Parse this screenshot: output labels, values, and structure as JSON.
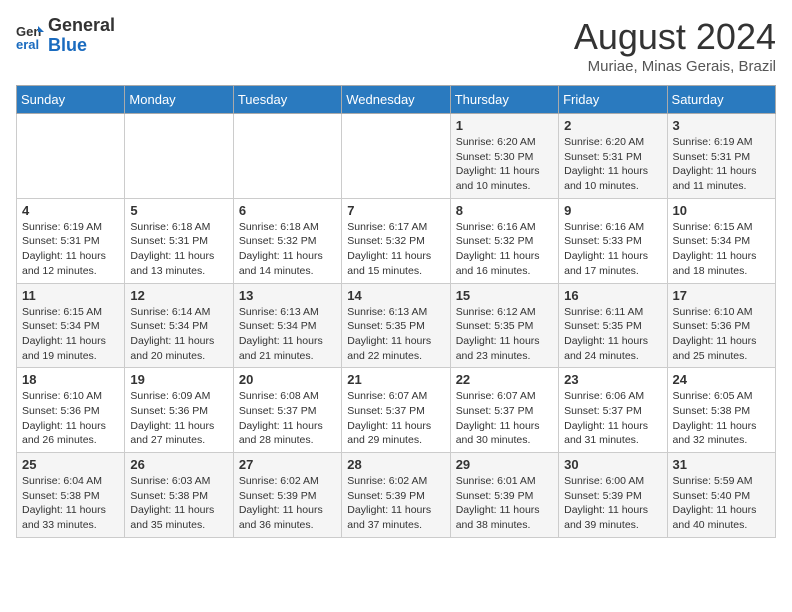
{
  "header": {
    "logo_line1": "General",
    "logo_line2": "Blue",
    "month_year": "August 2024",
    "location": "Muriae, Minas Gerais, Brazil"
  },
  "days_of_week": [
    "Sunday",
    "Monday",
    "Tuesday",
    "Wednesday",
    "Thursday",
    "Friday",
    "Saturday"
  ],
  "weeks": [
    [
      {
        "day": "",
        "info": ""
      },
      {
        "day": "",
        "info": ""
      },
      {
        "day": "",
        "info": ""
      },
      {
        "day": "",
        "info": ""
      },
      {
        "day": "1",
        "info": "Sunrise: 6:20 AM\nSunset: 5:30 PM\nDaylight: 11 hours and 10 minutes."
      },
      {
        "day": "2",
        "info": "Sunrise: 6:20 AM\nSunset: 5:31 PM\nDaylight: 11 hours and 10 minutes."
      },
      {
        "day": "3",
        "info": "Sunrise: 6:19 AM\nSunset: 5:31 PM\nDaylight: 11 hours and 11 minutes."
      }
    ],
    [
      {
        "day": "4",
        "info": "Sunrise: 6:19 AM\nSunset: 5:31 PM\nDaylight: 11 hours and 12 minutes."
      },
      {
        "day": "5",
        "info": "Sunrise: 6:18 AM\nSunset: 5:31 PM\nDaylight: 11 hours and 13 minutes."
      },
      {
        "day": "6",
        "info": "Sunrise: 6:18 AM\nSunset: 5:32 PM\nDaylight: 11 hours and 14 minutes."
      },
      {
        "day": "7",
        "info": "Sunrise: 6:17 AM\nSunset: 5:32 PM\nDaylight: 11 hours and 15 minutes."
      },
      {
        "day": "8",
        "info": "Sunrise: 6:16 AM\nSunset: 5:32 PM\nDaylight: 11 hours and 16 minutes."
      },
      {
        "day": "9",
        "info": "Sunrise: 6:16 AM\nSunset: 5:33 PM\nDaylight: 11 hours and 17 minutes."
      },
      {
        "day": "10",
        "info": "Sunrise: 6:15 AM\nSunset: 5:34 PM\nDaylight: 11 hours and 18 minutes."
      }
    ],
    [
      {
        "day": "11",
        "info": "Sunrise: 6:15 AM\nSunset: 5:34 PM\nDaylight: 11 hours and 19 minutes."
      },
      {
        "day": "12",
        "info": "Sunrise: 6:14 AM\nSunset: 5:34 PM\nDaylight: 11 hours and 20 minutes."
      },
      {
        "day": "13",
        "info": "Sunrise: 6:13 AM\nSunset: 5:34 PM\nDaylight: 11 hours and 21 minutes."
      },
      {
        "day": "14",
        "info": "Sunrise: 6:13 AM\nSunset: 5:35 PM\nDaylight: 11 hours and 22 minutes."
      },
      {
        "day": "15",
        "info": "Sunrise: 6:12 AM\nSunset: 5:35 PM\nDaylight: 11 hours and 23 minutes."
      },
      {
        "day": "16",
        "info": "Sunrise: 6:11 AM\nSunset: 5:35 PM\nDaylight: 11 hours and 24 minutes."
      },
      {
        "day": "17",
        "info": "Sunrise: 6:10 AM\nSunset: 5:36 PM\nDaylight: 11 hours and 25 minutes."
      }
    ],
    [
      {
        "day": "18",
        "info": "Sunrise: 6:10 AM\nSunset: 5:36 PM\nDaylight: 11 hours and 26 minutes."
      },
      {
        "day": "19",
        "info": "Sunrise: 6:09 AM\nSunset: 5:36 PM\nDaylight: 11 hours and 27 minutes."
      },
      {
        "day": "20",
        "info": "Sunrise: 6:08 AM\nSunset: 5:37 PM\nDaylight: 11 hours and 28 minutes."
      },
      {
        "day": "21",
        "info": "Sunrise: 6:07 AM\nSunset: 5:37 PM\nDaylight: 11 hours and 29 minutes."
      },
      {
        "day": "22",
        "info": "Sunrise: 6:07 AM\nSunset: 5:37 PM\nDaylight: 11 hours and 30 minutes."
      },
      {
        "day": "23",
        "info": "Sunrise: 6:06 AM\nSunset: 5:37 PM\nDaylight: 11 hours and 31 minutes."
      },
      {
        "day": "24",
        "info": "Sunrise: 6:05 AM\nSunset: 5:38 PM\nDaylight: 11 hours and 32 minutes."
      }
    ],
    [
      {
        "day": "25",
        "info": "Sunrise: 6:04 AM\nSunset: 5:38 PM\nDaylight: 11 hours and 33 minutes."
      },
      {
        "day": "26",
        "info": "Sunrise: 6:03 AM\nSunset: 5:38 PM\nDaylight: 11 hours and 35 minutes."
      },
      {
        "day": "27",
        "info": "Sunrise: 6:02 AM\nSunset: 5:39 PM\nDaylight: 11 hours and 36 minutes."
      },
      {
        "day": "28",
        "info": "Sunrise: 6:02 AM\nSunset: 5:39 PM\nDaylight: 11 hours and 37 minutes."
      },
      {
        "day": "29",
        "info": "Sunrise: 6:01 AM\nSunset: 5:39 PM\nDaylight: 11 hours and 38 minutes."
      },
      {
        "day": "30",
        "info": "Sunrise: 6:00 AM\nSunset: 5:39 PM\nDaylight: 11 hours and 39 minutes."
      },
      {
        "day": "31",
        "info": "Sunrise: 5:59 AM\nSunset: 5:40 PM\nDaylight: 11 hours and 40 minutes."
      }
    ]
  ]
}
